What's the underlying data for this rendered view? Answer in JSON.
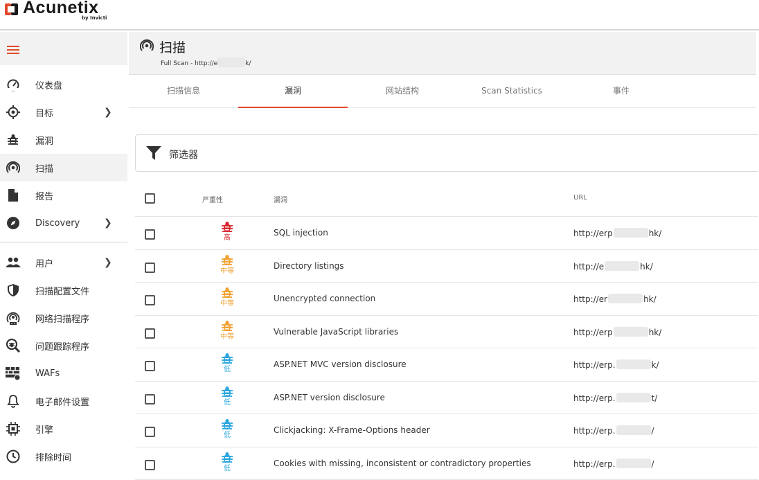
{
  "brand": {
    "name": "Acunetix",
    "sub": "by Invicti"
  },
  "sidebar": {
    "items": [
      {
        "label": "仪表盘",
        "icon": "dashboard-icon",
        "chevron": false
      },
      {
        "label": "目标",
        "icon": "target-icon",
        "chevron": true
      },
      {
        "label": "漏洞",
        "icon": "bug-icon",
        "chevron": false
      },
      {
        "label": "扫描",
        "icon": "scan-icon",
        "chevron": false,
        "active": true
      },
      {
        "label": "报告",
        "icon": "report-icon",
        "chevron": false
      },
      {
        "label": "Discovery",
        "icon": "compass-icon",
        "chevron": true
      }
    ],
    "items2": [
      {
        "label": "用户",
        "icon": "users-icon",
        "chevron": true
      },
      {
        "label": "扫描配置文件",
        "icon": "shield-icon",
        "chevron": false
      },
      {
        "label": "网络扫描程序",
        "icon": "network-scanner-icon",
        "chevron": false
      },
      {
        "label": "问题跟踪程序",
        "icon": "issue-tracker-icon",
        "chevron": false
      },
      {
        "label": "WAFs",
        "icon": "firewall-icon",
        "chevron": false
      },
      {
        "label": "电子邮件设置",
        "icon": "bell-icon",
        "chevron": false
      },
      {
        "label": "引擎",
        "icon": "chip-icon",
        "chevron": false
      },
      {
        "label": "排除时间",
        "icon": "clock-icon",
        "chevron": false
      }
    ]
  },
  "header": {
    "title": "扫描",
    "subtitle_prefix": "Full Scan - http://e",
    "subtitle_suffix": "k/"
  },
  "tabs": [
    {
      "label": "扫描信息"
    },
    {
      "label": "漏洞",
      "active": true
    },
    {
      "label": "网站结构"
    },
    {
      "label": "Scan Statistics"
    },
    {
      "label": "事件"
    }
  ],
  "filter": {
    "label": "筛选器"
  },
  "table": {
    "headers": {
      "severity": "严重性",
      "vuln": "漏洞",
      "url": "URL"
    },
    "rows": [
      {
        "severity": "高",
        "color": "#d9232d",
        "name": "SQL injection",
        "url_a": "http://erp",
        "url_b": "hk/"
      },
      {
        "severity": "中等",
        "color": "#f0a030",
        "name": "Directory listings",
        "url_a": "http://e",
        "url_b": "hk/"
      },
      {
        "severity": "中等",
        "color": "#f0a030",
        "name": "Unencrypted connection",
        "url_a": "http://er",
        "url_b": "hk/"
      },
      {
        "severity": "中等",
        "color": "#f0a030",
        "name": "Vulnerable JavaScript libraries",
        "url_a": "http://erp",
        "url_b": "hk/"
      },
      {
        "severity": "低",
        "color": "#2aa6de",
        "name": "ASP.NET MVC version disclosure",
        "url_a": "http://erp.",
        "url_b": "k/"
      },
      {
        "severity": "低",
        "color": "#2aa6de",
        "name": "ASP.NET version disclosure",
        "url_a": "http://erp.",
        "url_b": "t/"
      },
      {
        "severity": "低",
        "color": "#2aa6de",
        "name": "Clickjacking: X-Frame-Options header",
        "url_a": "http://erp.",
        "url_b": "/"
      },
      {
        "severity": "低",
        "color": "#2aa6de",
        "name": "Cookies with missing, inconsistent or contradictory properties",
        "url_a": "http://erp.",
        "url_b": "/"
      }
    ]
  }
}
